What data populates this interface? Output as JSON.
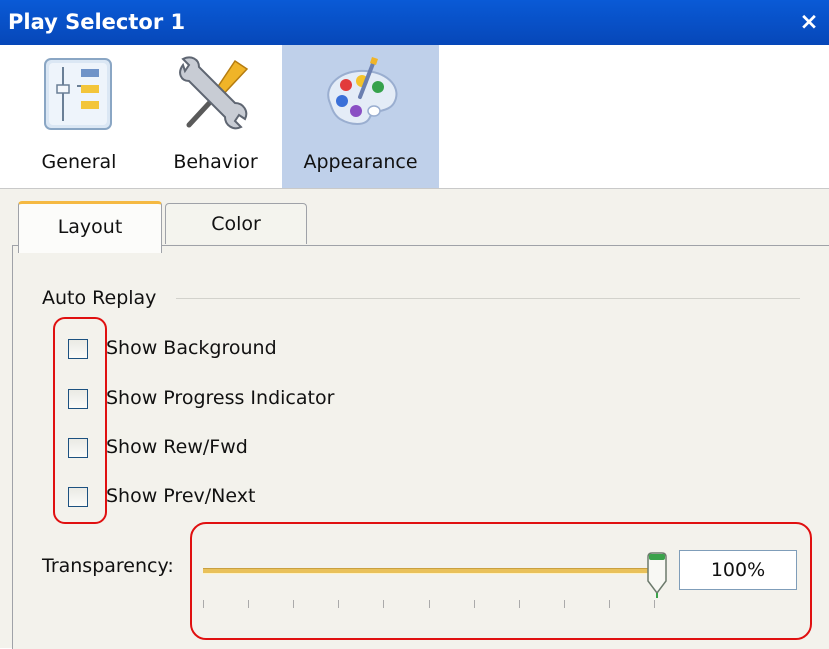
{
  "window": {
    "title": "Play Selector 1",
    "close_symbol": "×"
  },
  "categories": [
    {
      "label": "General",
      "icon": "general-settings-icon",
      "selected": false
    },
    {
      "label": "Behavior",
      "icon": "tools-icon",
      "selected": false
    },
    {
      "label": "Appearance",
      "icon": "palette-icon",
      "selected": true
    }
  ],
  "tabs": [
    {
      "label": "Layout",
      "active": true
    },
    {
      "label": "Color",
      "active": false
    }
  ],
  "auto_replay": {
    "title": "Auto Replay",
    "options": [
      {
        "label": "Show Background",
        "checked": false
      },
      {
        "label": "Show Progress Indicator",
        "checked": false
      },
      {
        "label": "Show Rew/Fwd",
        "checked": false
      },
      {
        "label": "Show Prev/Next",
        "checked": false
      }
    ]
  },
  "transparency": {
    "label": "Transparency:",
    "value_text": "100%",
    "value": 100
  },
  "colors": {
    "titlebar": "#0550c8",
    "selected_category": "#bfd0ea",
    "active_tab_accent": "#f5b942",
    "annotation": "#e01010",
    "slider_track": "#e9c15a",
    "slider_thumb": "#3aa24a"
  }
}
